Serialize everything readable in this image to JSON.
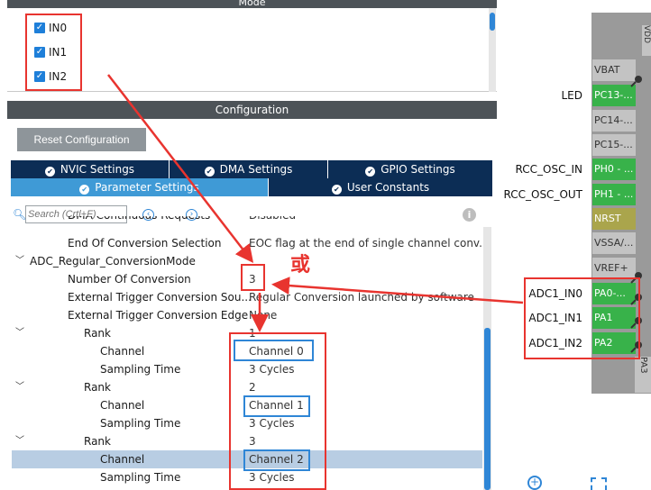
{
  "mode": {
    "title": "Mode",
    "checkboxes": [
      {
        "label": "IN0",
        "checked": true
      },
      {
        "label": "IN1",
        "checked": true
      },
      {
        "label": "IN2",
        "checked": true
      }
    ]
  },
  "configuration": {
    "title": "Configuration",
    "reset_label": "Reset Configuration",
    "tabs_row1": [
      {
        "label": "NVIC Settings"
      },
      {
        "label": "DMA Settings"
      },
      {
        "label": "GPIO Settings"
      }
    ],
    "tabs_row2": [
      {
        "label": "Parameter Settings",
        "active": true
      },
      {
        "label": "User Constants",
        "active": false
      }
    ],
    "search_placeholder": "Search (Crtl+F)",
    "tree": [
      {
        "label": "DMA Continuous Requests",
        "value": "Disabled"
      },
      {
        "label": "End Of Conversion Selection",
        "value": "EOC flag at the end of single channel conv..."
      },
      {
        "label": "ADC_Regular_ConversionMode",
        "value": ""
      },
      {
        "label": "Number Of Conversion",
        "value": "3"
      },
      {
        "label": "External Trigger Conversion Sou...",
        "value": "Regular Conversion launched by software"
      },
      {
        "label": "External Trigger Conversion Edge",
        "value": "None"
      },
      {
        "label": "Rank",
        "value": "1"
      },
      {
        "label": "Channel",
        "value": "Channel 0"
      },
      {
        "label": "Sampling Time",
        "value": "3 Cycles"
      },
      {
        "label": "Rank",
        "value": "2"
      },
      {
        "label": "Channel",
        "value": "Channel 1"
      },
      {
        "label": "Sampling Time",
        "value": "3 Cycles"
      },
      {
        "label": "Rank",
        "value": "3"
      },
      {
        "label": "Channel",
        "value": "Channel 2"
      },
      {
        "label": "Sampling Time",
        "value": "3 Cycles"
      }
    ]
  },
  "annotation": {
    "or_text": "或",
    "color": "#e8342f",
    "blue": "#2f86d6"
  },
  "chip": {
    "pins": [
      {
        "label": "VDD",
        "side_label": ""
      },
      {
        "label": "VBAT",
        "side_label": ""
      },
      {
        "label": "PC13-...",
        "side_label": "LED"
      },
      {
        "label": "PC14-...",
        "side_label": ""
      },
      {
        "label": "PC15-...",
        "side_label": ""
      },
      {
        "label": "PH0 - ...",
        "side_label": "RCC_OSC_IN"
      },
      {
        "label": "PH1 - ...",
        "side_label": "RCC_OSC_OUT"
      },
      {
        "label": "NRST",
        "side_label": ""
      },
      {
        "label": "VSSA/...",
        "side_label": ""
      },
      {
        "label": "VREF+",
        "side_label": ""
      },
      {
        "label": "PA0-...",
        "side_label": "ADC1_IN0"
      },
      {
        "label": "PA1",
        "side_label": "ADC1_IN1"
      },
      {
        "label": "PA2",
        "side_label": "ADC1_IN2"
      },
      {
        "label": "PA3",
        "side_label": ""
      }
    ]
  }
}
